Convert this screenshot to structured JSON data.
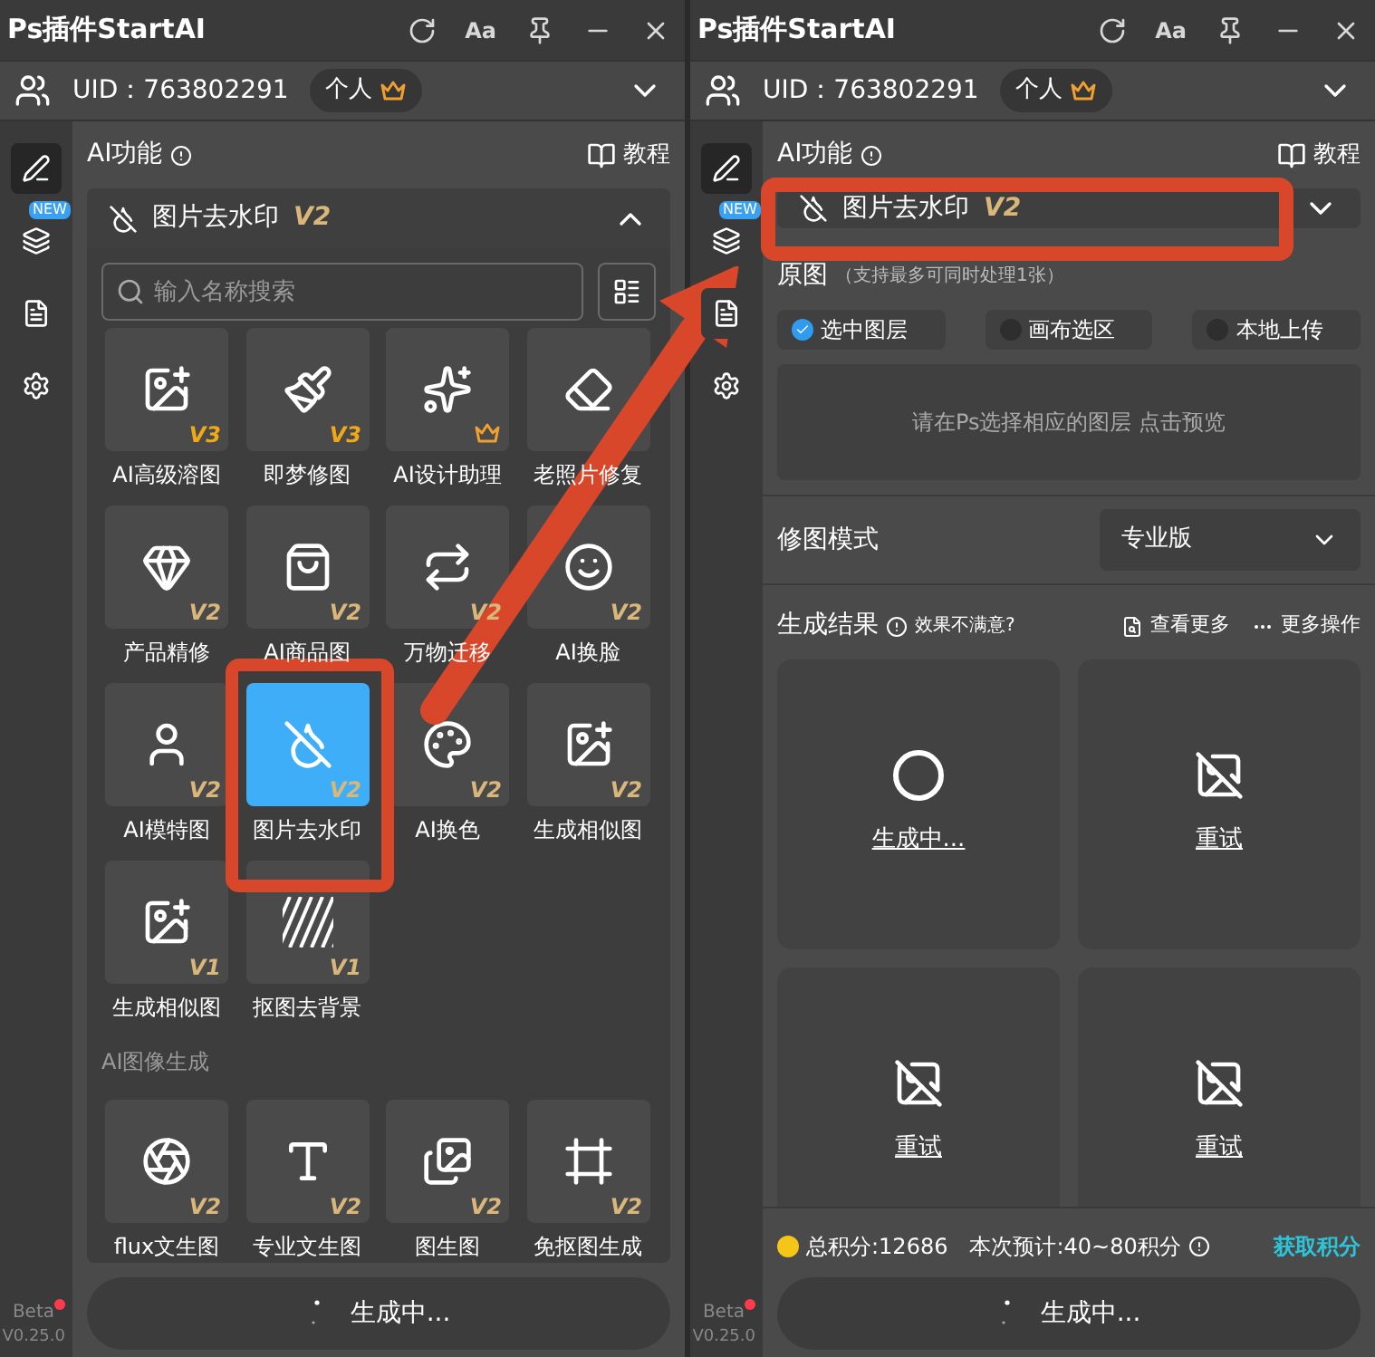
{
  "panels": [
    {
      "kind": "picker",
      "title": "Ps插件StartAI",
      "font_button": "Aa",
      "uid": "UID：763802291",
      "plan": "个人",
      "sidebar": {
        "items": [
          {
            "kind": "edit",
            "selected": true
          },
          {
            "kind": "layers",
            "selected": false,
            "badge": "NEW"
          },
          {
            "kind": "document",
            "selected": false
          },
          {
            "kind": "settings",
            "selected": false
          }
        ],
        "beta": "Beta",
        "version": "V0.25.0"
      },
      "section_title": "AI功能",
      "tutorial": "教程",
      "selector": {
        "label": "图片去水印",
        "version": "V2",
        "expanded": true
      },
      "picker": {
        "search_placeholder": "输入名称搜索",
        "groups": [
          {
            "tools": [
              {
                "kind": "blend",
                "label": "AI高级溶图",
                "version": "V3",
                "premium": false,
                "selected": false
              },
              {
                "kind": "dream",
                "label": "即梦修图",
                "version": "V3",
                "premium": false,
                "selected": false
              },
              {
                "kind": "design",
                "label": "AI设计助理",
                "premium": true,
                "selected": false
              },
              {
                "kind": "restore",
                "label": "老照片修复",
                "premium": false,
                "selected": false
              },
              {
                "kind": "refine",
                "label": "产品精修",
                "version": "V2",
                "premium": false,
                "selected": false
              },
              {
                "kind": "product",
                "label": "AI商品图",
                "version": "V2",
                "premium": false,
                "selected": false
              },
              {
                "kind": "transfer",
                "label": "万物迁移",
                "version": "V2",
                "premium": false,
                "selected": false
              },
              {
                "kind": "faceswap",
                "label": "AI换脸",
                "version": "V2",
                "premium": false,
                "selected": false
              },
              {
                "kind": "model",
                "label": "AI模特图",
                "version": "V2",
                "premium": false,
                "selected": false
              },
              {
                "kind": "watermark",
                "label": "图片去水印",
                "version": "V2",
                "premium": false,
                "selected": true
              },
              {
                "kind": "recolor",
                "label": "AI换色",
                "version": "V2",
                "premium": false,
                "selected": false
              },
              {
                "kind": "similar",
                "label": "生成相似图",
                "version": "V2",
                "premium": false,
                "selected": false
              },
              {
                "kind": "similar",
                "label": "生成相似图",
                "version": "V1",
                "premium": false,
                "selected": false
              },
              {
                "kind": "cutout",
                "label": "抠图去背景",
                "version": "V1",
                "premium": false,
                "selected": false
              }
            ]
          },
          {
            "title": "AI图像生成",
            "tools": [
              {
                "kind": "flux",
                "label": "flux文生图",
                "version": "V2",
                "premium": false,
                "selected": false
              },
              {
                "kind": "text2img",
                "label": "专业文生图",
                "version": "V2",
                "premium": false,
                "selected": false
              },
              {
                "kind": "img2img",
                "label": "图生图",
                "version": "V2",
                "premium": false,
                "selected": false
              },
              {
                "kind": "nocutout",
                "label": "免抠图生成",
                "version": "V2",
                "premium": false,
                "selected": false
              }
            ]
          }
        ]
      },
      "generate_button": "生成中..."
    },
    {
      "kind": "form",
      "title": "Ps插件StartAI",
      "font_button": "Aa",
      "uid": "UID：763802291",
      "plan": "个人",
      "sidebar": {
        "items": [
          {
            "kind": "edit",
            "selected": true
          },
          {
            "kind": "layers",
            "selected": false,
            "badge": "NEW"
          },
          {
            "kind": "document",
            "selected": false
          },
          {
            "kind": "settings",
            "selected": false
          }
        ],
        "beta": "Beta",
        "version": "V0.25.0"
      },
      "section_title": "AI功能",
      "tutorial": "教程",
      "selector": {
        "label": "图片去水印",
        "version": "V2",
        "expanded": false
      },
      "source": {
        "label": "原图",
        "hint": "（支持最多可同时处理1张）",
        "options": [
          {
            "label": "选中图层",
            "selected": true
          },
          {
            "label": "画布选区",
            "selected": false
          },
          {
            "label": "本地上传",
            "selected": false
          }
        ],
        "preview_hint": "请在Ps选择相应的图层 点击预览"
      },
      "mode": {
        "label": "修图模式",
        "value": "专业版"
      },
      "results": {
        "title": "生成结果",
        "feedback": "效果不满意?",
        "view_more": "查看更多",
        "more_actions": "更多操作",
        "items": [
          {
            "kind": "loading",
            "label": "生成中..."
          },
          {
            "kind": "failed",
            "label": "重试"
          },
          {
            "kind": "failed",
            "label": "重试"
          },
          {
            "kind": "failed",
            "label": "重试"
          }
        ]
      },
      "points": {
        "total": "总积分:12686",
        "estimate": "本次预计:40~80积分",
        "link": "获取积分"
      },
      "generate_button": "生成中..."
    }
  ]
}
